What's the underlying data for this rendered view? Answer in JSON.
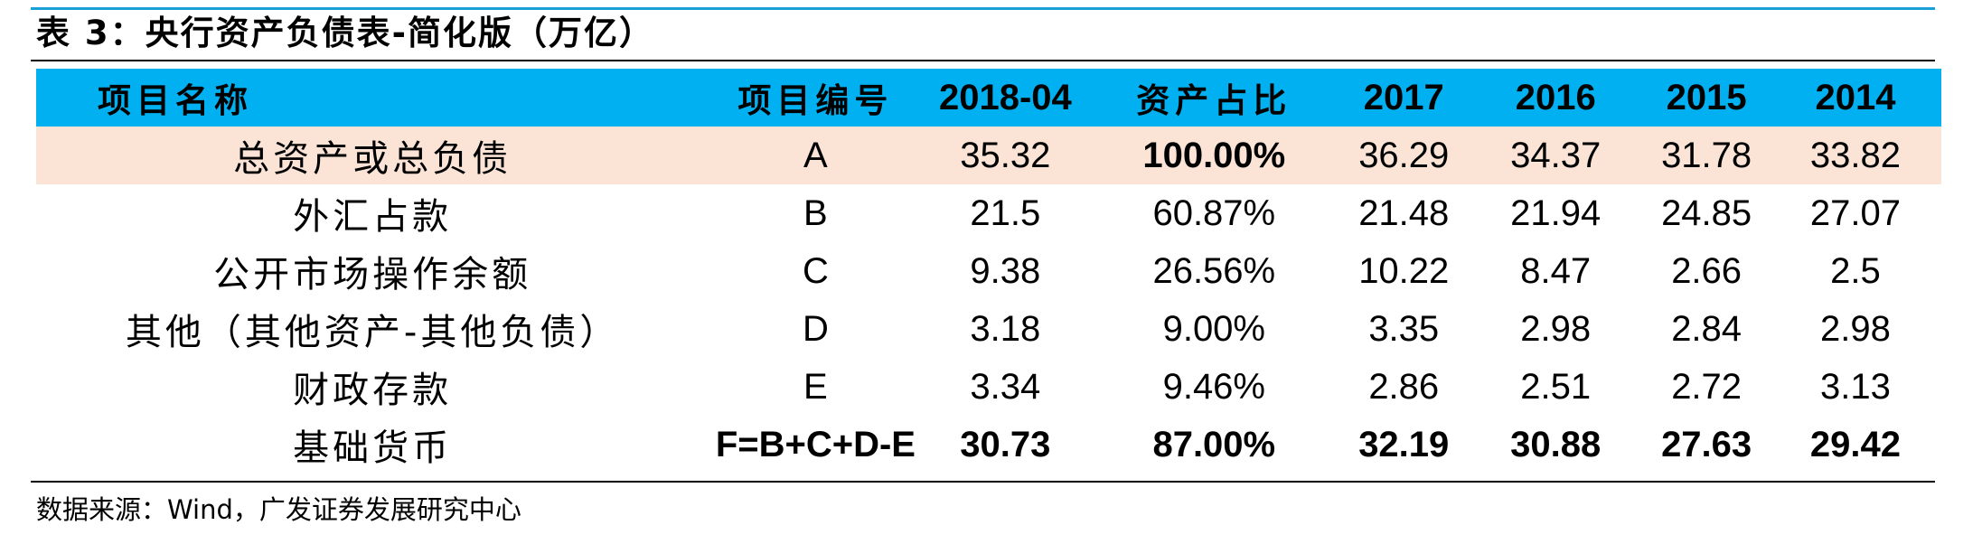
{
  "caption": "表 3：央行资产负债表-简化版（万亿）",
  "header": {
    "item_name": "项目名称",
    "item_code": "项目编号",
    "col_201804": "2018-04",
    "share": "资产占比",
    "col_2017": "2017",
    "col_2016": "2016",
    "col_2015": "2015",
    "col_2014": "2014"
  },
  "rows": [
    {
      "name": "总资产或总负债",
      "code": "A",
      "v201804": "35.32",
      "share": "100.00%",
      "v2017": "36.29",
      "v2016": "34.37",
      "v2015": "31.78",
      "v2014": "33.82"
    },
    {
      "name": "外汇占款",
      "code": "B",
      "v201804": "21.5",
      "share": "60.87%",
      "v2017": "21.48",
      "v2016": "21.94",
      "v2015": "24.85",
      "v2014": "27.07"
    },
    {
      "name": "公开市场操作余额",
      "code": "C",
      "v201804": "9.38",
      "share": "26.56%",
      "v2017": "10.22",
      "v2016": "8.47",
      "v2015": "2.66",
      "v2014": "2.5"
    },
    {
      "name": "其他（其他资产-其他负债）",
      "code": "D",
      "v201804": "3.18",
      "share": "9.00%",
      "v2017": "3.35",
      "v2016": "2.98",
      "v2015": "2.84",
      "v2014": "2.98"
    },
    {
      "name": "财政存款",
      "code": "E",
      "v201804": "3.34",
      "share": "9.46%",
      "v2017": "2.86",
      "v2016": "2.51",
      "v2015": "2.72",
      "v2014": "3.13"
    },
    {
      "name": "基础货币",
      "code": "F=B+C+D-E",
      "v201804": "30.73",
      "share": "87.00%",
      "v2017": "32.19",
      "v2016": "30.88",
      "v2015": "27.63",
      "v2014": "29.42"
    }
  ],
  "source": "数据来源：Wind，广发证券发展研究中心",
  "colors": {
    "header_bg": "#00b0f0",
    "highlight_bg": "#fbe3d6",
    "rule": "#1a9fd9"
  }
}
